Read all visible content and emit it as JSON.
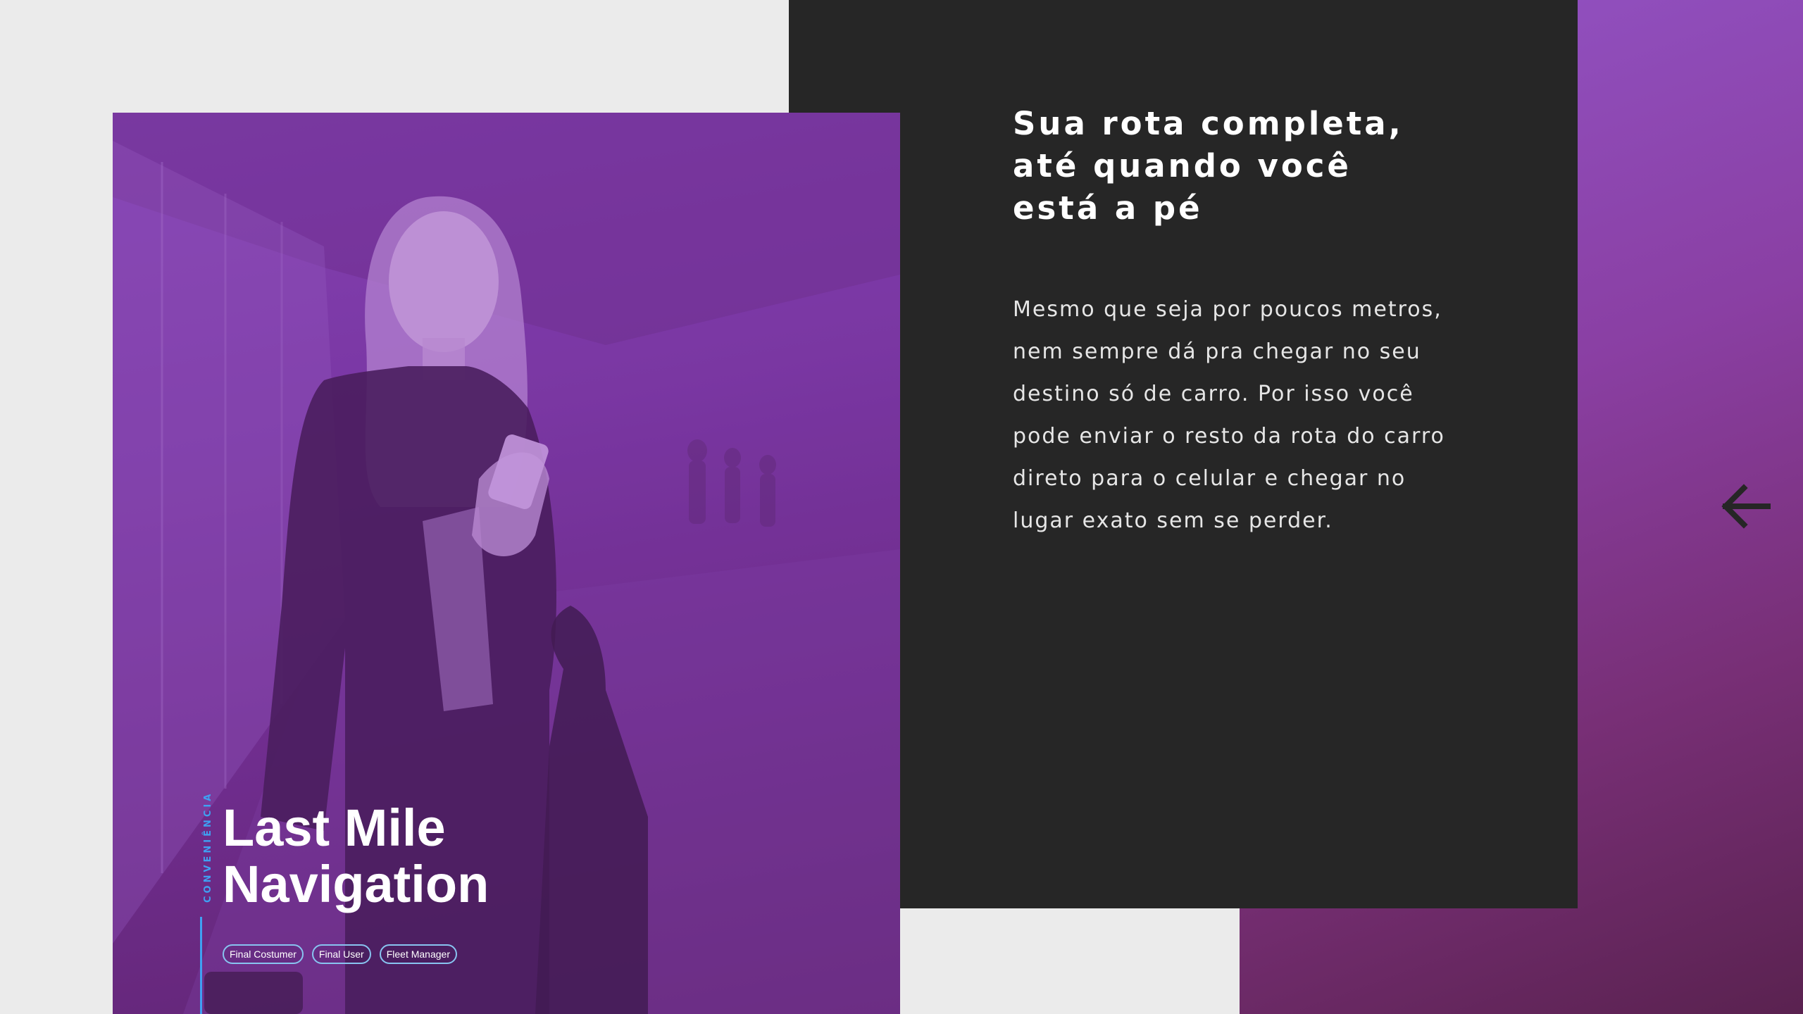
{
  "card": {
    "category_label": "CONVENIÊNCIA",
    "title": "Last Mile\nNavigation",
    "tags": [
      "Final Costumer",
      "Final User",
      "Fleet Manager"
    ]
  },
  "content": {
    "heading": "Sua rota completa,\naté quando você\nestá a pé",
    "body": "Mesmo que seja por poucos metros,\nnem sempre dá pra chegar no seu\ndestino só de carro. Por isso você\npode enviar o resto da rota do carro\ndireto para o celular e chegar no\nlugar exato sem se perder."
  },
  "navigation": {
    "back_icon": "arrow-left-icon"
  },
  "colors": {
    "accent_blue": "#3fa0f2",
    "dark_panel": "#262626",
    "purple": "#8a3fa3",
    "page_bg": "#ebebeb"
  }
}
